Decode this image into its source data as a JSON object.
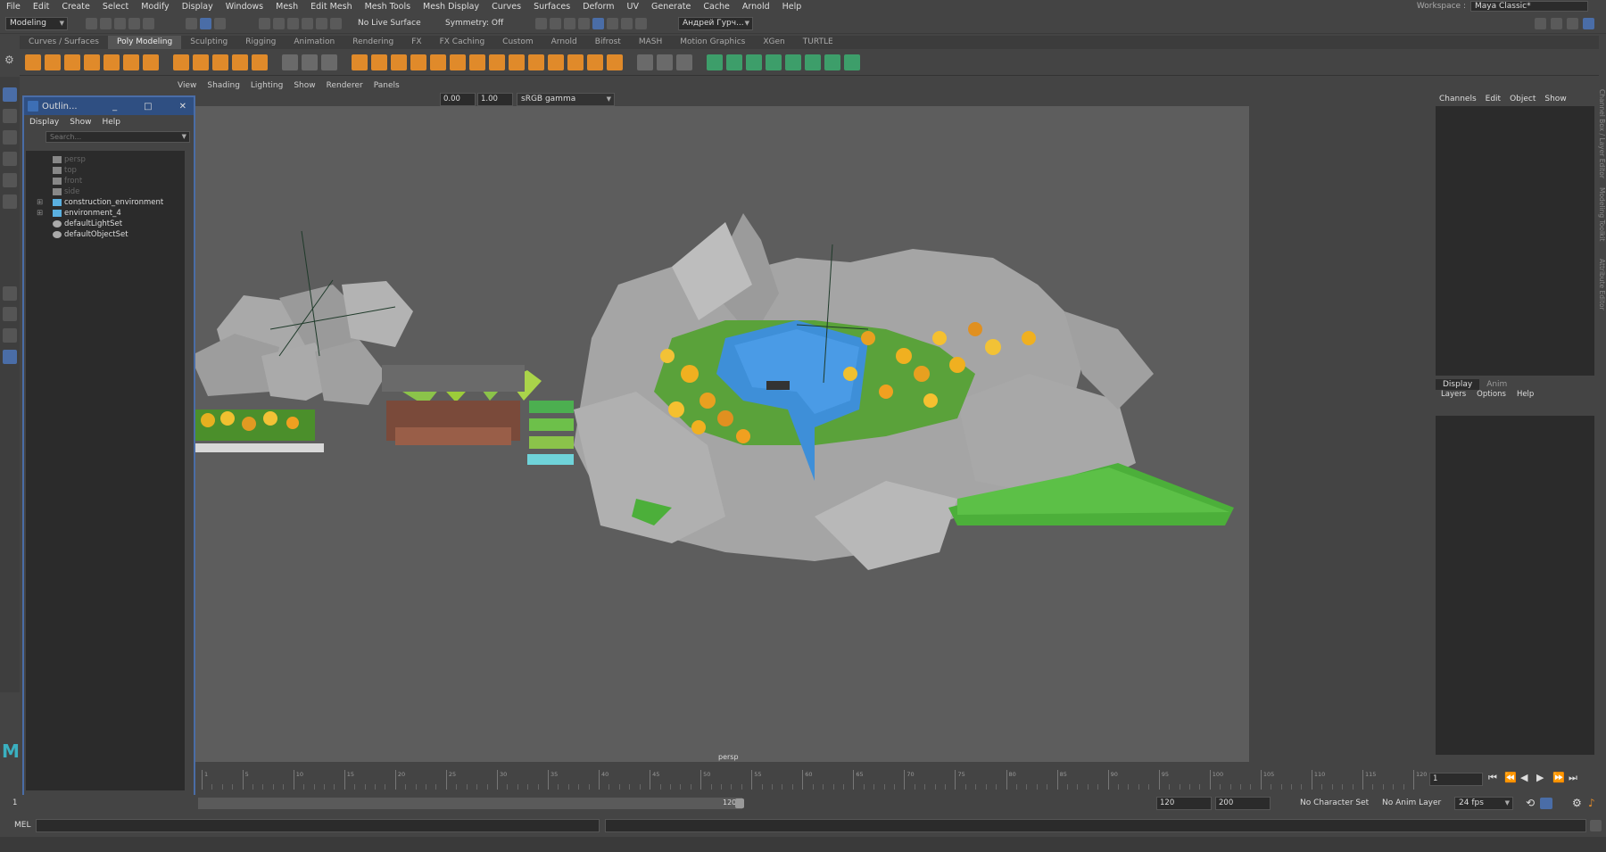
{
  "app": {
    "name": "Maya"
  },
  "menubar": {
    "items": [
      "File",
      "Edit",
      "Create",
      "Select",
      "Modify",
      "Display",
      "Windows",
      "Mesh",
      "Edit Mesh",
      "Mesh Tools",
      "Mesh Display",
      "Curves",
      "Surfaces",
      "Deform",
      "UV",
      "Generate",
      "Cache",
      "Arnold",
      "Help"
    ]
  },
  "workspace": {
    "label": "Workspace :",
    "value": "Maya Classic*"
  },
  "statusline": {
    "mode": "Modeling",
    "live_surface": "No Live Surface",
    "symmetry": "Symmetry: Off",
    "user": "Андрей Гурч..."
  },
  "shelf_tabs": {
    "items": [
      "Curves / Surfaces",
      "Poly Modeling",
      "Sculpting",
      "Rigging",
      "Animation",
      "Rendering",
      "FX",
      "FX Caching",
      "Custom",
      "Arnold",
      "Bifrost",
      "MASH",
      "Motion Graphics",
      "XGen",
      "TURTLE"
    ],
    "active": "Poly Modeling"
  },
  "viewport": {
    "menus": [
      "View",
      "Shading",
      "Lighting",
      "Show",
      "Renderer",
      "Panels"
    ],
    "exposure": "0.00",
    "gamma": "1.00",
    "color_space": "sRGB gamma",
    "camera_label": "persp"
  },
  "outliner": {
    "title": "Outlin...",
    "menus": [
      "Display",
      "Show",
      "Help"
    ],
    "search_placeholder": "Search...",
    "items": [
      {
        "label": "persp",
        "dim": true
      },
      {
        "label": "top",
        "dim": true
      },
      {
        "label": "front",
        "dim": true
      },
      {
        "label": "side",
        "dim": true
      },
      {
        "label": "construction_environment",
        "dim": false
      },
      {
        "label": "environment_4",
        "dim": false
      },
      {
        "label": "defaultLightSet",
        "dim": false
      },
      {
        "label": "defaultObjectSet",
        "dim": false
      }
    ]
  },
  "channel_box": {
    "menus": [
      "Channels",
      "Edit",
      "Object",
      "Show"
    ],
    "side_tabs": [
      "Channel Box / Layer Editor",
      "Modeling Toolkit",
      "Attribute Editor"
    ]
  },
  "layer_editor": {
    "tabs": [
      "Display",
      "Anim"
    ],
    "active_tab": "Display",
    "menus": [
      "Layers",
      "Options",
      "Help"
    ]
  },
  "timeline": {
    "ticks": [
      "1",
      "5",
      "10",
      "15",
      "20",
      "25",
      "30",
      "35",
      "40",
      "45",
      "50",
      "55",
      "60",
      "65",
      "70",
      "75",
      "80",
      "85",
      "90",
      "95",
      "100",
      "105",
      "110",
      "115",
      "120"
    ],
    "current_frame": "1"
  },
  "range": {
    "start": "1",
    "range_start": "1",
    "range_end_slider": "120",
    "range_end": "120",
    "anim_end": "200",
    "character_set": "No Character Set",
    "anim_layer": "No Anim Layer",
    "fps": "24 fps"
  },
  "cmdline": {
    "language": "MEL"
  },
  "colors": {
    "accent": "#4a6da7",
    "shelf_icon_orange": "#e08a2a",
    "shelf_icon_green": "#3d9e6a",
    "viewport_bg": "#5d5d5d"
  }
}
